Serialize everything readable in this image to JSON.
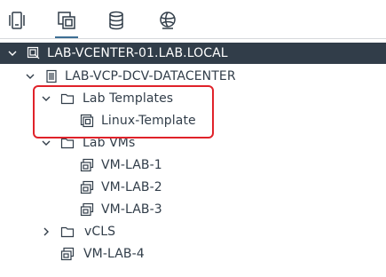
{
  "tabs": [
    {
      "icon": "hosts-and-clusters-icon",
      "active": false
    },
    {
      "icon": "vms-and-templates-icon",
      "active": true
    },
    {
      "icon": "storage-icon",
      "active": false
    },
    {
      "icon": "networking-icon",
      "active": false
    }
  ],
  "tree": {
    "vcenter": {
      "label": "LAB-VCENTER-01.LAB.LOCAL",
      "icon": "vcenter-icon",
      "expanded": true,
      "selected": true
    },
    "datacenter": {
      "label": "LAB-VCP-DCV-DATACENTER",
      "icon": "datacenter-icon",
      "expanded": true
    },
    "folder_templates": {
      "label": "Lab Templates",
      "icon": "folder-icon",
      "expanded": true
    },
    "template_linux": {
      "label": "Linux-Template",
      "icon": "vm-template-icon"
    },
    "folder_vms": {
      "label": "Lab VMs",
      "icon": "folder-icon",
      "expanded": true
    },
    "vm1": {
      "label": "VM-LAB-1",
      "icon": "vm-icon"
    },
    "vm2": {
      "label": "VM-LAB-2",
      "icon": "vm-icon"
    },
    "vm3": {
      "label": "VM-LAB-3",
      "icon": "vm-icon"
    },
    "folder_vcls": {
      "label": "vCLS",
      "icon": "folder-icon",
      "expanded": false
    },
    "vm4": {
      "label": "VM-LAB-4",
      "icon": "vm-icon"
    }
  },
  "colors": {
    "accent": "#3d6f94",
    "selected_bg": "#313d49",
    "highlight_border": "#e0222a"
  }
}
